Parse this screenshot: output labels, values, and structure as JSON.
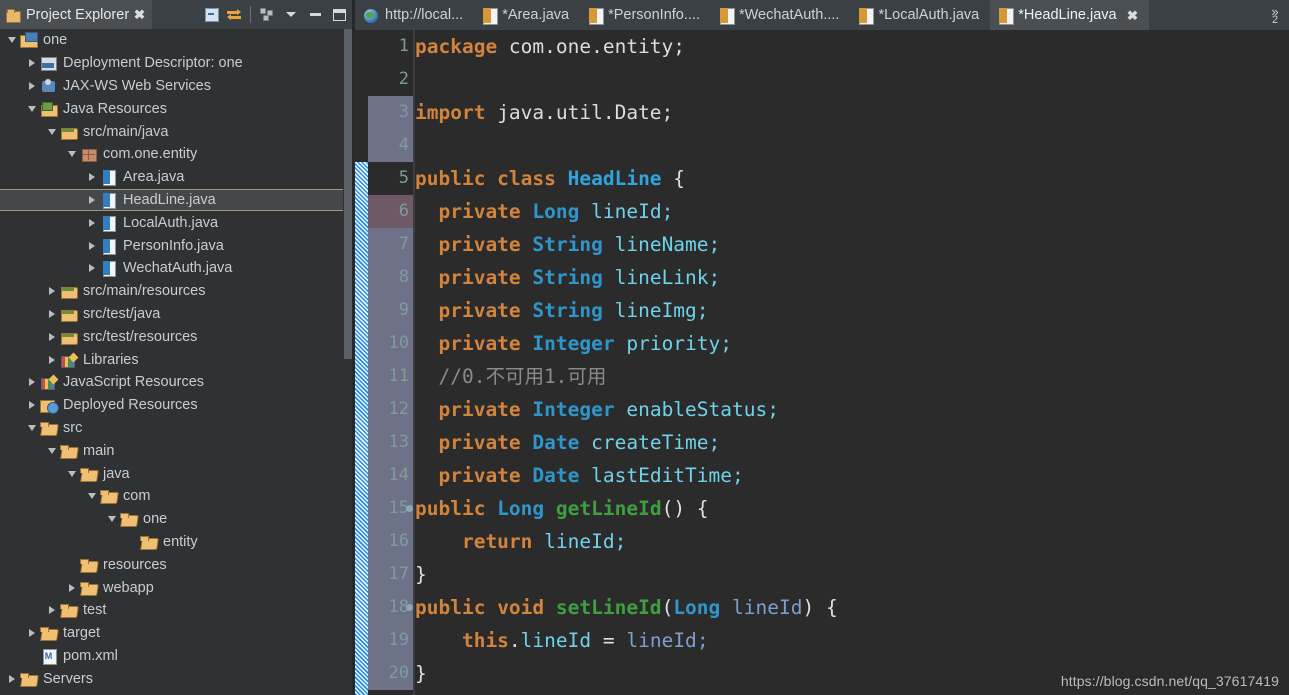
{
  "explorer": {
    "tab_title": "Project Explorer",
    "close_label": "✖",
    "toolbar": [
      {
        "name": "collapse-all-icon",
        "title": "Collapse All"
      },
      {
        "name": "link-with-editor-icon",
        "title": "Link with Editor"
      },
      {
        "name": "view-menu-icon",
        "title": "View Menu"
      },
      {
        "name": "chevron-down-icon",
        "title": "Minimize Menu"
      },
      {
        "name": "minimize-icon",
        "title": "Minimize"
      },
      {
        "name": "maximize-icon",
        "title": "Maximize"
      }
    ],
    "tree": [
      {
        "label": "one",
        "depth": 0,
        "twisty": "open",
        "icon": "ic-prj",
        "selected": false
      },
      {
        "label": "Deployment Descriptor: one",
        "depth": 1,
        "twisty": "closed",
        "icon": "ic-deploy",
        "selected": false
      },
      {
        "label": "JAX-WS Web Services",
        "depth": 1,
        "twisty": "closed",
        "icon": "ic-ws",
        "selected": false
      },
      {
        "label": "Java Resources",
        "depth": 1,
        "twisty": "open",
        "icon": "ic-javares",
        "selected": false
      },
      {
        "label": "src/main/java",
        "depth": 2,
        "twisty": "open",
        "icon": "ic-srcfolder",
        "selected": false
      },
      {
        "label": "com.one.entity",
        "depth": 3,
        "twisty": "open",
        "icon": "ic-pkg",
        "selected": false
      },
      {
        "label": "Area.java",
        "depth": 4,
        "twisty": "closed",
        "icon": "ic-java",
        "selected": false
      },
      {
        "label": "HeadLine.java",
        "depth": 4,
        "twisty": "closed",
        "icon": "ic-java",
        "selected": true
      },
      {
        "label": "LocalAuth.java",
        "depth": 4,
        "twisty": "closed",
        "icon": "ic-java",
        "selected": false
      },
      {
        "label": "PersonInfo.java",
        "depth": 4,
        "twisty": "closed",
        "icon": "ic-java",
        "selected": false
      },
      {
        "label": "WechatAuth.java",
        "depth": 4,
        "twisty": "closed",
        "icon": "ic-java",
        "selected": false
      },
      {
        "label": "src/main/resources",
        "depth": 2,
        "twisty": "closed",
        "icon": "ic-srcfolder",
        "selected": false
      },
      {
        "label": "src/test/java",
        "depth": 2,
        "twisty": "closed",
        "icon": "ic-srcfolder",
        "selected": false
      },
      {
        "label": "src/test/resources",
        "depth": 2,
        "twisty": "closed",
        "icon": "ic-srcfolder",
        "selected": false
      },
      {
        "label": "Libraries",
        "depth": 2,
        "twisty": "closed",
        "icon": "ic-lib",
        "selected": false
      },
      {
        "label": "JavaScript Resources",
        "depth": 1,
        "twisty": "closed",
        "icon": "ic-lib",
        "selected": false
      },
      {
        "label": "Deployed Resources",
        "depth": 1,
        "twisty": "closed",
        "icon": "ic-deployres",
        "selected": false
      },
      {
        "label": "src",
        "depth": 1,
        "twisty": "open",
        "icon": "ic-folder",
        "selected": false
      },
      {
        "label": "main",
        "depth": 2,
        "twisty": "open",
        "icon": "ic-folder",
        "selected": false
      },
      {
        "label": "java",
        "depth": 3,
        "twisty": "open",
        "icon": "ic-folder",
        "selected": false
      },
      {
        "label": "com",
        "depth": 4,
        "twisty": "open",
        "icon": "ic-folder",
        "selected": false
      },
      {
        "label": "one",
        "depth": 5,
        "twisty": "open",
        "icon": "ic-folder",
        "selected": false
      },
      {
        "label": "entity",
        "depth": 6,
        "twisty": "none",
        "icon": "ic-folder",
        "selected": false
      },
      {
        "label": "resources",
        "depth": 3,
        "twisty": "none",
        "icon": "ic-folder",
        "selected": false
      },
      {
        "label": "webapp",
        "depth": 3,
        "twisty": "closed",
        "icon": "ic-folder",
        "selected": false
      },
      {
        "label": "test",
        "depth": 2,
        "twisty": "closed",
        "icon": "ic-folder",
        "selected": false
      },
      {
        "label": "target",
        "depth": 1,
        "twisty": "closed",
        "icon": "ic-folder",
        "selected": false
      },
      {
        "label": "pom.xml",
        "depth": 1,
        "twisty": "none",
        "icon": "ic-xml",
        "selected": false
      },
      {
        "label": "Servers",
        "depth": 0,
        "twisty": "closed",
        "icon": "ic-folder",
        "selected": false
      }
    ]
  },
  "editor": {
    "tabs": [
      {
        "label": "http://local...",
        "icon": "web-icon",
        "active": false,
        "closable": false
      },
      {
        "label": "*Area.java",
        "icon": "java-icon",
        "active": false,
        "closable": false
      },
      {
        "label": "*PersonInfo....",
        "icon": "java-icon",
        "active": false,
        "closable": false
      },
      {
        "label": "*WechatAuth....",
        "icon": "java-icon",
        "active": false,
        "closable": false
      },
      {
        "label": "*LocalAuth.java",
        "icon": "java-icon",
        "active": false,
        "closable": false
      },
      {
        "label": "*HeadLine.java",
        "icon": "java-icon",
        "active": true,
        "closable": true
      }
    ],
    "tab_close_label": "✖",
    "overflow_chevron": "»",
    "overflow_count": "2",
    "first_visible_line": 1,
    "code_lines": [
      {
        "n": 1,
        "tokens": [
          {
            "t": "package ",
            "c": "k"
          },
          {
            "t": "com.one.entity;",
            "c": "pkg"
          }
        ]
      },
      {
        "n": 2,
        "tokens": []
      },
      {
        "n": 3,
        "tokens": [
          {
            "t": "import ",
            "c": "k"
          },
          {
            "t": "java.util.Date;",
            "c": "pkg"
          }
        ]
      },
      {
        "n": 4,
        "tokens": []
      },
      {
        "n": 5,
        "tokens": [
          {
            "t": "public class ",
            "c": "k"
          },
          {
            "t": "HeadLine",
            "c": "cls"
          },
          {
            "t": " {",
            "c": "pn"
          }
        ]
      },
      {
        "n": 6,
        "tokens": [
          {
            "t": "  private ",
            "c": "k"
          },
          {
            "t": "Long",
            "c": "ty"
          },
          {
            "t": " ",
            "c": "pn"
          },
          {
            "t": "lineId",
            "c": "fld"
          },
          {
            "t": ";",
            "c": "fld"
          }
        ]
      },
      {
        "n": 7,
        "tokens": [
          {
            "t": "  private ",
            "c": "k"
          },
          {
            "t": "String",
            "c": "ty"
          },
          {
            "t": " ",
            "c": "pn"
          },
          {
            "t": "lineName",
            "c": "fld"
          },
          {
            "t": ";",
            "c": "fld"
          }
        ]
      },
      {
        "n": 8,
        "tokens": [
          {
            "t": "  private ",
            "c": "k"
          },
          {
            "t": "String",
            "c": "ty"
          },
          {
            "t": " ",
            "c": "pn"
          },
          {
            "t": "lineLink",
            "c": "fld"
          },
          {
            "t": ";",
            "c": "fld"
          }
        ]
      },
      {
        "n": 9,
        "tokens": [
          {
            "t": "  private ",
            "c": "k"
          },
          {
            "t": "String",
            "c": "ty"
          },
          {
            "t": " ",
            "c": "pn"
          },
          {
            "t": "lineImg",
            "c": "fld"
          },
          {
            "t": ";",
            "c": "fld"
          }
        ]
      },
      {
        "n": 10,
        "tokens": [
          {
            "t": "  private ",
            "c": "k"
          },
          {
            "t": "Integer",
            "c": "ty"
          },
          {
            "t": " ",
            "c": "pn"
          },
          {
            "t": "priority",
            "c": "fld"
          },
          {
            "t": ";",
            "c": "fld"
          }
        ]
      },
      {
        "n": 11,
        "tokens": [
          {
            "t": "  //0.不可用1.可用",
            "c": "cm"
          }
        ]
      },
      {
        "n": 12,
        "tokens": [
          {
            "t": "  private ",
            "c": "k"
          },
          {
            "t": "Integer",
            "c": "ty"
          },
          {
            "t": " ",
            "c": "pn"
          },
          {
            "t": "enableStatus",
            "c": "fld"
          },
          {
            "t": ";",
            "c": "fld"
          }
        ]
      },
      {
        "n": 13,
        "tokens": [
          {
            "t": "  private ",
            "c": "k"
          },
          {
            "t": "Date",
            "c": "ty"
          },
          {
            "t": " ",
            "c": "pn"
          },
          {
            "t": "createTime",
            "c": "fld"
          },
          {
            "t": ";",
            "c": "fld"
          }
        ]
      },
      {
        "n": 14,
        "tokens": [
          {
            "t": "  private ",
            "c": "k"
          },
          {
            "t": "Date",
            "c": "ty"
          },
          {
            "t": " ",
            "c": "pn"
          },
          {
            "t": "lastEditTime",
            "c": "fld"
          },
          {
            "t": ";",
            "c": "fld"
          }
        ]
      },
      {
        "n": 15,
        "tokens": [
          {
            "t": "public ",
            "c": "k"
          },
          {
            "t": "Long",
            "c": "ty"
          },
          {
            "t": " ",
            "c": "pn"
          },
          {
            "t": "getLineId",
            "c": "mth"
          },
          {
            "t": "() {",
            "c": "pn"
          }
        ]
      },
      {
        "n": 16,
        "tokens": [
          {
            "t": "    return ",
            "c": "k"
          },
          {
            "t": "lineId",
            "c": "fld"
          },
          {
            "t": ";",
            "c": "fld"
          }
        ]
      },
      {
        "n": 17,
        "tokens": [
          {
            "t": "}",
            "c": "pn"
          }
        ]
      },
      {
        "n": 18,
        "tokens": [
          {
            "t": "public ",
            "c": "k"
          },
          {
            "t": "void ",
            "c": "k"
          },
          {
            "t": "setLineId",
            "c": "mth"
          },
          {
            "t": "(",
            "c": "pn"
          },
          {
            "t": "Long",
            "c": "ty"
          },
          {
            "t": " ",
            "c": "pn"
          },
          {
            "t": "lineId",
            "c": "par"
          },
          {
            "t": ") {",
            "c": "pn"
          }
        ]
      },
      {
        "n": 19,
        "tokens": [
          {
            "t": "    this",
            "c": "k"
          },
          {
            "t": ".",
            "c": "pn"
          },
          {
            "t": "lineId",
            "c": "fld"
          },
          {
            "t": " = ",
            "c": "pn"
          },
          {
            "t": "lineId",
            "c": "par"
          },
          {
            "t": ";",
            "c": "par"
          }
        ]
      },
      {
        "n": 20,
        "tokens": [
          {
            "t": "}",
            "c": "pn"
          }
        ]
      }
    ],
    "fold_markers": [
      15,
      18
    ],
    "changed_lines": [
      3,
      4,
      6,
      7,
      8,
      9,
      10,
      11,
      12,
      13,
      14,
      15,
      16,
      17,
      18,
      19,
      20
    ],
    "changed_alt_lines": [
      6
    ]
  },
  "watermark": "https://blog.csdn.net/qq_37617419",
  "colors": {
    "editor_bg": "#2b2b2b",
    "panel_bg": "#2f3133",
    "titlebar_bg": "#3b4045",
    "active_tab_bg": "#4a4f54",
    "keyword": "#d2833c",
    "type": "#2f96cc",
    "field": "#6fd2e8",
    "method": "#3f9e3f",
    "parameter": "#7e9ed0",
    "comment": "#8a8a8a",
    "linenumber": "#7e9c9c",
    "selection_border": "#9e9a6a",
    "diff_marker": "#2196f3"
  }
}
